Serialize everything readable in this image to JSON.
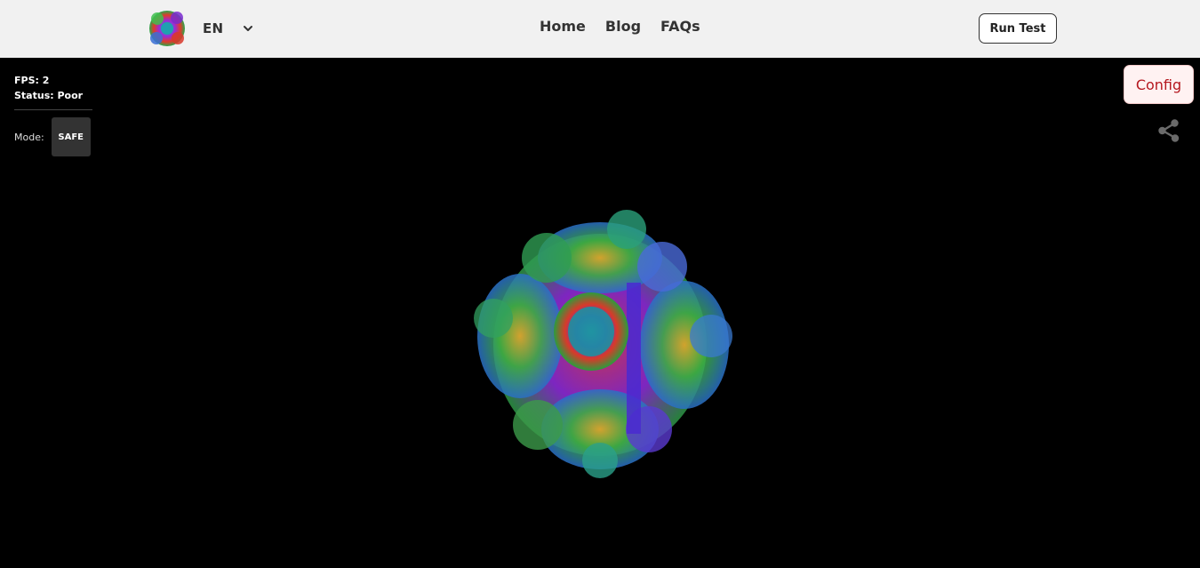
{
  "header": {
    "language": "EN",
    "nav": [
      {
        "label": "Home"
      },
      {
        "label": "Blog"
      },
      {
        "label": "FAQs"
      }
    ],
    "run_test_label": "Run Test"
  },
  "stats": {
    "fps_label": "FPS: 2",
    "status_label": "Status: Poor"
  },
  "mode": {
    "label": "Mode:",
    "value": "SAFE"
  },
  "config_label": "Config",
  "icons": {
    "logo": "fractal-logo-icon",
    "language_toggle": "chevron-down-icon",
    "share": "share-icon"
  },
  "colors": {
    "header_bg": "#f1f1f1",
    "canvas_bg": "#000000",
    "config_text": "#b5181f",
    "config_bg": "#fff2f2",
    "mode_button_bg": "#333333"
  }
}
